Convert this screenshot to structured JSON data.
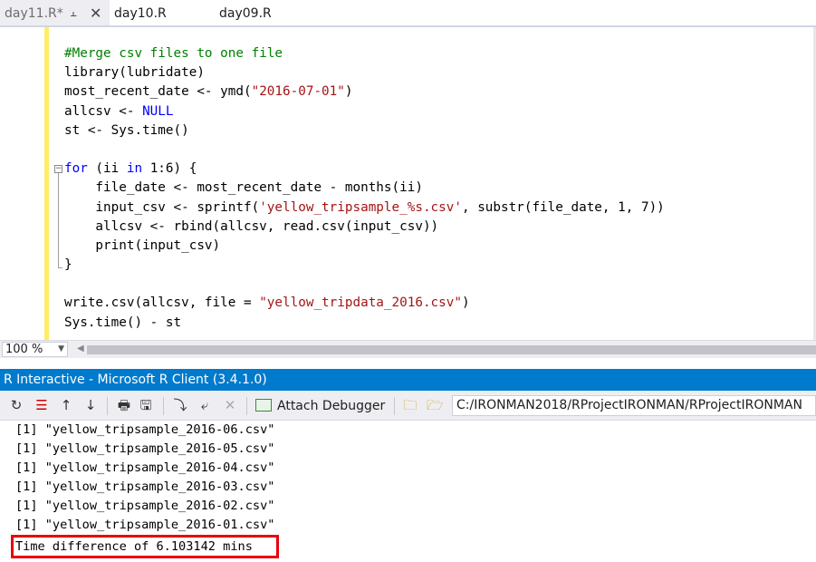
{
  "tabs": [
    {
      "label": "day11.R*",
      "active": true
    },
    {
      "label": "day10.R",
      "active": false
    },
    {
      "label": "day09.R",
      "active": false
    }
  ],
  "code_lines": [
    {
      "parts": [
        {
          "t": "#Merge csv files to one file",
          "c": "cm"
        }
      ]
    },
    {
      "parts": [
        {
          "t": "library(lubridate)",
          "c": ""
        }
      ]
    },
    {
      "parts": [
        {
          "t": "most_recent_date <- ymd(",
          "c": ""
        },
        {
          "t": "\"2016-07-01\"",
          "c": "st"
        },
        {
          "t": ")",
          "c": ""
        }
      ]
    },
    {
      "parts": [
        {
          "t": "allcsv <- ",
          "c": ""
        },
        {
          "t": "NULL",
          "c": "kw"
        }
      ]
    },
    {
      "parts": [
        {
          "t": "st <- Sys.time()",
          "c": ""
        }
      ]
    },
    {
      "parts": [
        {
          "t": "",
          "c": ""
        }
      ]
    },
    {
      "parts": [
        {
          "t": "for",
          "c": "kw"
        },
        {
          "t": " (ii ",
          "c": ""
        },
        {
          "t": "in",
          "c": "kw"
        },
        {
          "t": " 1:6) {",
          "c": ""
        }
      ]
    },
    {
      "parts": [
        {
          "t": "    file_date <- most_recent_date - months(ii)",
          "c": ""
        }
      ]
    },
    {
      "parts": [
        {
          "t": "    input_csv <- sprintf(",
          "c": ""
        },
        {
          "t": "'yellow_tripsample_%s.csv'",
          "c": "st"
        },
        {
          "t": ", substr(file_date, 1, 7))",
          "c": ""
        }
      ]
    },
    {
      "parts": [
        {
          "t": "    allcsv <- rbind(allcsv, read.csv(input_csv))",
          "c": ""
        }
      ]
    },
    {
      "parts": [
        {
          "t": "    print(input_csv)",
          "c": ""
        }
      ]
    },
    {
      "parts": [
        {
          "t": "}",
          "c": ""
        }
      ]
    },
    {
      "parts": [
        {
          "t": "",
          "c": ""
        }
      ]
    },
    {
      "parts": [
        {
          "t": "write.csv(allcsv, file = ",
          "c": ""
        },
        {
          "t": "\"yellow_tripdata_2016.csv\"",
          "c": "st"
        },
        {
          "t": ")",
          "c": ""
        }
      ]
    },
    {
      "parts": [
        {
          "t": "Sys.time() - st",
          "c": ""
        }
      ]
    }
  ],
  "zoom": "100 %",
  "interactive": {
    "title": "R Interactive - Microsoft R Client (3.4.1.0)",
    "attach_label": "Attach Debugger",
    "path": "C:/IRONMAN2018/RProjectIRONMAN/RProjectIRONMAN",
    "output_lines": [
      "[1] \"yellow_tripsample_2016-06.csv\"",
      "[1] \"yellow_tripsample_2016-05.csv\"",
      "[1] \"yellow_tripsample_2016-04.csv\"",
      "[1] \"yellow_tripsample_2016-03.csv\"",
      "[1] \"yellow_tripsample_2016-02.csv\"",
      "[1] \"yellow_tripsample_2016-01.csv\""
    ],
    "time_line": "Time difference of 6.103142 mins"
  },
  "colors": {
    "accent": "#007acc",
    "highlight": "#e8000b",
    "change_bar": "#ffee62"
  }
}
